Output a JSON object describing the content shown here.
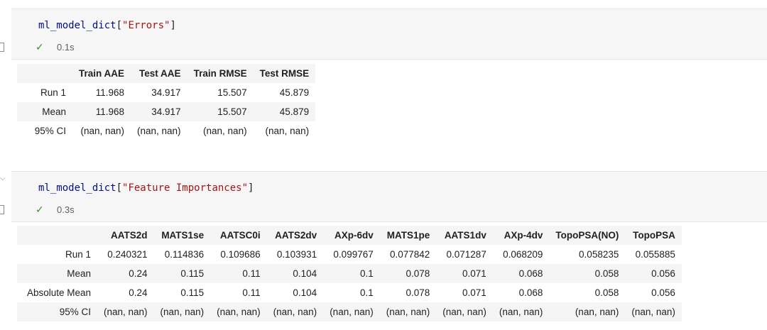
{
  "cells": [
    {
      "code": {
        "var": "ml_model_dict",
        "open": "[",
        "key": "\"Errors\"",
        "close": "]"
      },
      "status": "0.1s",
      "table": {
        "columns": [
          "Train AAE",
          "Test AAE",
          "Train RMSE",
          "Test RMSE"
        ],
        "rows": [
          {
            "label": "Run 1",
            "values": [
              "11.968",
              "34.917",
              "15.507",
              "45.879"
            ]
          },
          {
            "label": "Mean",
            "values": [
              "11.968",
              "34.917",
              "15.507",
              "45.879"
            ]
          },
          {
            "label": "95% CI",
            "values": [
              "(nan, nan)",
              "(nan, nan)",
              "(nan, nan)",
              "(nan, nan)"
            ]
          }
        ]
      }
    },
    {
      "code": {
        "var": "ml_model_dict",
        "open": "[",
        "key": "\"Feature Importances\"",
        "close": "]"
      },
      "status": "0.3s",
      "table": {
        "columns": [
          "AATS2d",
          "MATS1se",
          "AATSC0i",
          "AATS2dv",
          "AXp-6dv",
          "MATS1pe",
          "AATS1dv",
          "AXp-4dv",
          "TopoPSA(NO)",
          "TopoPSA"
        ],
        "rows": [
          {
            "label": "Run 1",
            "values": [
              "0.240321",
              "0.114836",
              "0.109686",
              "0.103931",
              "0.099767",
              "0.077842",
              "0.071287",
              "0.068209",
              "0.058235",
              "0.055885"
            ]
          },
          {
            "label": "Mean",
            "values": [
              "0.24",
              "0.115",
              "0.11",
              "0.104",
              "0.1",
              "0.078",
              "0.071",
              "0.068",
              "0.058",
              "0.056"
            ]
          },
          {
            "label": "Absolute Mean",
            "values": [
              "0.24",
              "0.115",
              "0.11",
              "0.104",
              "0.1",
              "0.078",
              "0.071",
              "0.068",
              "0.058",
              "0.056"
            ]
          },
          {
            "label": "95% CI",
            "values": [
              "(nan, nan)",
              "(nan, nan)",
              "(nan, nan)",
              "(nan, nan)",
              "(nan, nan)",
              "(nan, nan)",
              "(nan, nan)",
              "(nan, nan)",
              "(nan, nan)",
              "(nan, nan)"
            ]
          }
        ]
      }
    }
  ],
  "icons": {
    "status_check": "check-icon",
    "collapse": "chevron-down-icon"
  },
  "colors": {
    "check": "#388a34",
    "string": "#a31515",
    "identifier": "#001080"
  }
}
